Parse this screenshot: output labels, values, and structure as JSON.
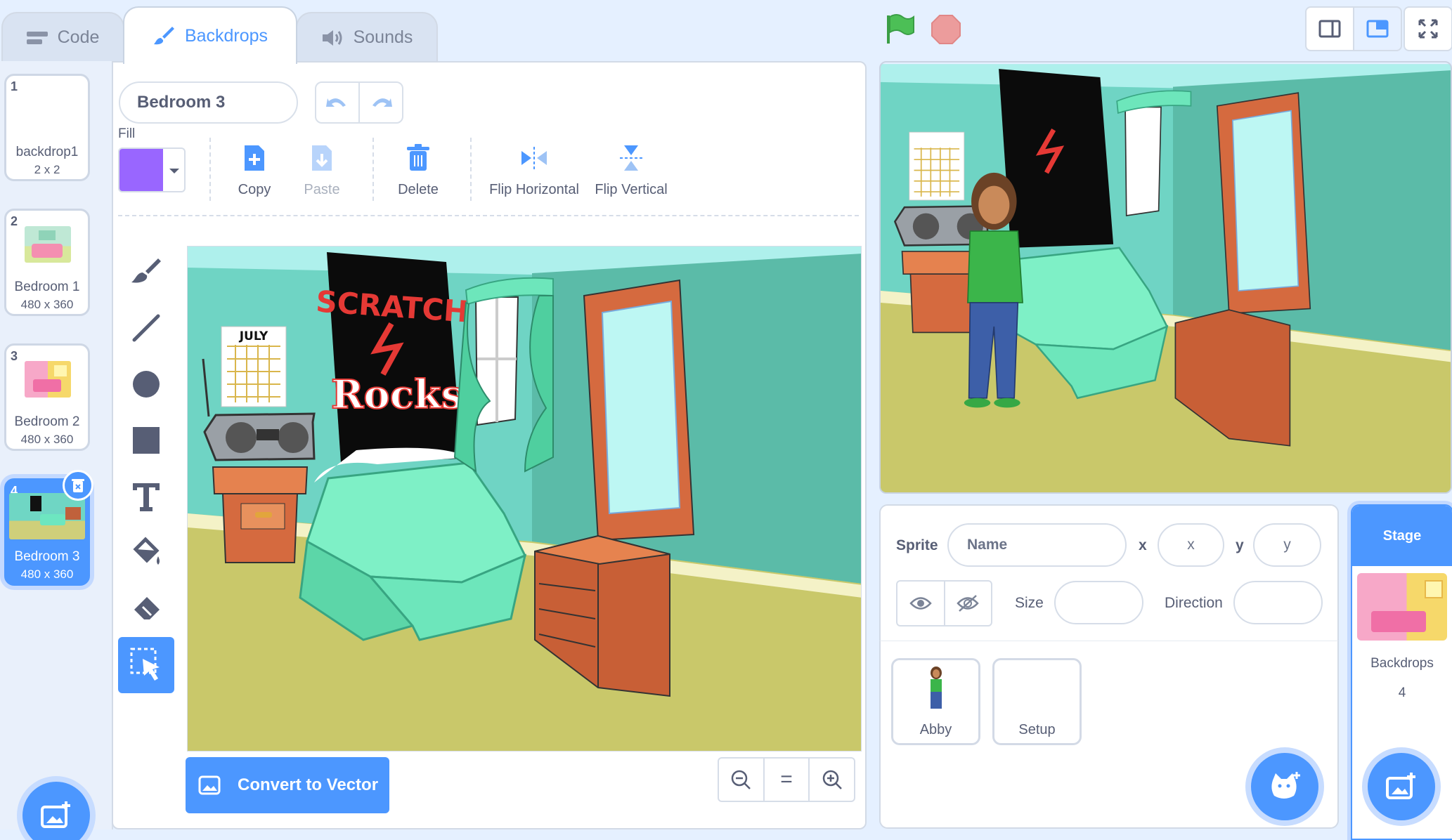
{
  "tabs": {
    "code": "Code",
    "backdrops": "Backdrops",
    "sounds": "Sounds"
  },
  "costumes": [
    {
      "num": "1",
      "name": "backdrop1",
      "size": "2 x 2"
    },
    {
      "num": "2",
      "name": "Bedroom 1",
      "size": "480 x 360"
    },
    {
      "num": "3",
      "name": "Bedroom 2",
      "size": "480 x 360"
    },
    {
      "num": "4",
      "name": "Bedroom 3",
      "size": "480 x 360"
    }
  ],
  "editor": {
    "costume_name": "Bedroom 3",
    "fill_label": "Fill",
    "fill_color": "#9966ff",
    "copy": "Copy",
    "paste": "Paste",
    "delete": "Delete",
    "flip_h": "Flip Horizontal",
    "flip_v": "Flip Vertical",
    "convert": "Convert to Vector",
    "zoom_reset": "="
  },
  "poster": {
    "line1": "SCRATCH",
    "line2": "Rocks"
  },
  "calendar": "JULY",
  "sprite_info": {
    "sprite_label": "Sprite",
    "name_placeholder": "Name",
    "x_label": "x",
    "x_placeholder": "x",
    "y_label": "y",
    "y_placeholder": "y",
    "size_label": "Size",
    "direction_label": "Direction"
  },
  "sprites": [
    {
      "name": "Abby"
    },
    {
      "name": "Setup"
    }
  ],
  "stage_panel": {
    "title": "Stage",
    "backdrops_label": "Backdrops",
    "backdrops_count": "4"
  },
  "colors": {
    "accent": "#4c97ff",
    "flag": "#4cbf56",
    "stop": "#ec9c9c"
  }
}
